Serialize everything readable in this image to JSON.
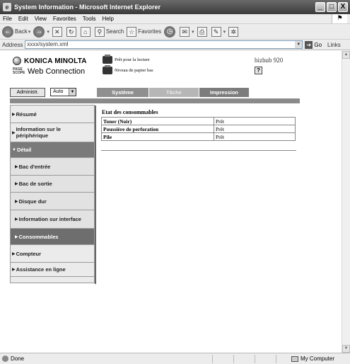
{
  "window": {
    "title": "System Information - Microsoft Internet Explorer",
    "controls": [
      "_",
      "□",
      "X"
    ]
  },
  "menu": [
    "File",
    "Edit",
    "View",
    "Favorites",
    "Tools",
    "Help"
  ],
  "toolbar": {
    "back": "Back",
    "search": "Search",
    "favorites": "Favorites"
  },
  "address": {
    "label": "Address",
    "value": "xxxx/system.xml",
    "go": "Go",
    "links": "Links"
  },
  "status": {
    "left": "Done",
    "zone": "My Computer"
  },
  "page": {
    "brand": "KONICA MINOLTA",
    "pagescope": "PAGE SCOPE",
    "webconnection": "Web Connection",
    "status1": "Prêt pour la lecture",
    "status2": "Niveau de papier bas",
    "model": "bizhub 920",
    "help": "?",
    "admin_button": "Administr.",
    "mode": "Auto",
    "tabs": [
      "Système",
      "Tâche",
      "Impression"
    ],
    "sidebar": [
      {
        "label": "Résumé"
      },
      {
        "label": "Information sur le périphérique"
      },
      {
        "label": "Détail"
      },
      {
        "label": "Bac d'entrée"
      },
      {
        "label": "Bac de sortie"
      },
      {
        "label": "Disque dur"
      },
      {
        "label": "Information sur interface"
      },
      {
        "label": "Consommables"
      },
      {
        "label": "Compteur"
      },
      {
        "label": "Assistance en ligne"
      }
    ],
    "content_title": "Etat des consommables",
    "table": [
      {
        "item": "Toner (Noir)",
        "status": "Prêt"
      },
      {
        "item": "Poussière de perforation",
        "status": "Prêt"
      },
      {
        "item": "Pile",
        "status": "Prêt"
      }
    ]
  }
}
